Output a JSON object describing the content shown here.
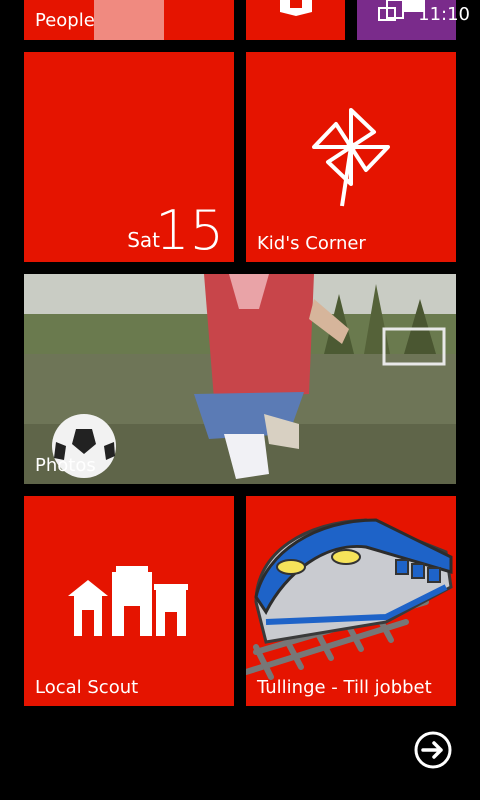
{
  "status": {
    "time": "11:10"
  },
  "tiles": {
    "people": {
      "label": "People"
    },
    "calendar": {
      "day": "Sat",
      "date": "15"
    },
    "kids_corner": {
      "label": "Kid's Corner"
    },
    "photos": {
      "label": "Photos"
    },
    "local_scout": {
      "label": "Local Scout"
    },
    "custom": {
      "label": "Tullinge - Till jobbet"
    }
  },
  "colors": {
    "accent": "#e51400",
    "background": "#000000",
    "purple_tile": "#7a2b8b"
  },
  "icons": {
    "office": "office-icon",
    "purple": "photo-stack-icon",
    "kids": "pinwheel-icon",
    "scout": "buildings-icon",
    "more": "arrow-right-circle-icon"
  }
}
